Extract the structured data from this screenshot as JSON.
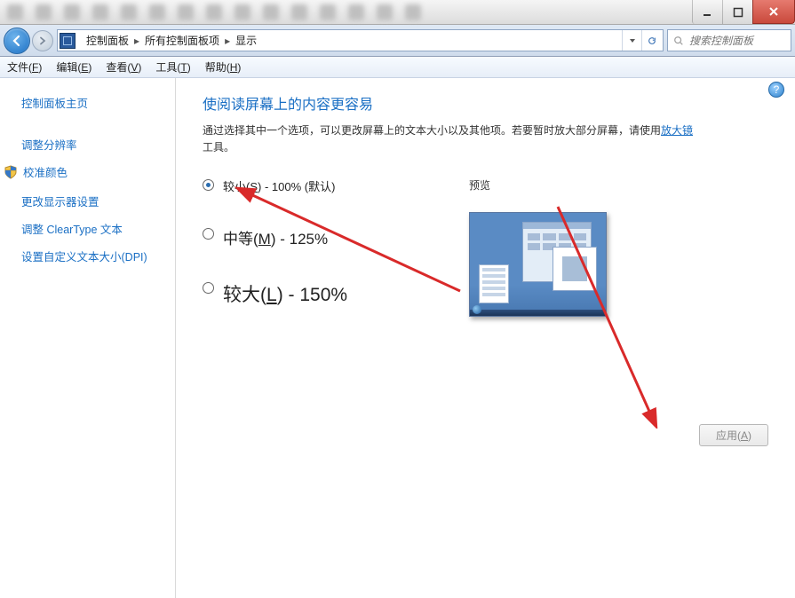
{
  "window_buttons": {
    "min": "minimize",
    "max": "maximize",
    "close": "close"
  },
  "breadcrumbs": {
    "root": "控制面板",
    "group": "所有控制面板项",
    "current": "显示"
  },
  "search": {
    "placeholder": "搜索控制面板"
  },
  "menu": {
    "file": "文件(F)",
    "edit": "编辑(E)",
    "view": "查看(V)",
    "tools": "工具(T)",
    "help": "帮助(H)"
  },
  "sidebar": {
    "home": "控制面板主页",
    "resolution": "调整分辨率",
    "calibrate": "校准颜色",
    "display_settings": "更改显示器设置",
    "cleartype": "调整 ClearType 文本",
    "dpi": "设置自定义文本大小(DPI)"
  },
  "main": {
    "heading": "使阅读屏幕上的内容更容易",
    "desc_pre": "通过选择其中一个选项，可以更改屏幕上的文本大小以及其他项。若要暂时放大部分屏幕，请使用",
    "magnifier_link": "放大镜",
    "desc_post": "工具。",
    "options": {
      "small": "较小(S) - 100% (默认)",
      "medium": "中等(M) - 125%",
      "large": "较大(L) - 150%"
    },
    "preview_label": "预览",
    "apply": "应用(A)"
  },
  "help_icon": "?"
}
